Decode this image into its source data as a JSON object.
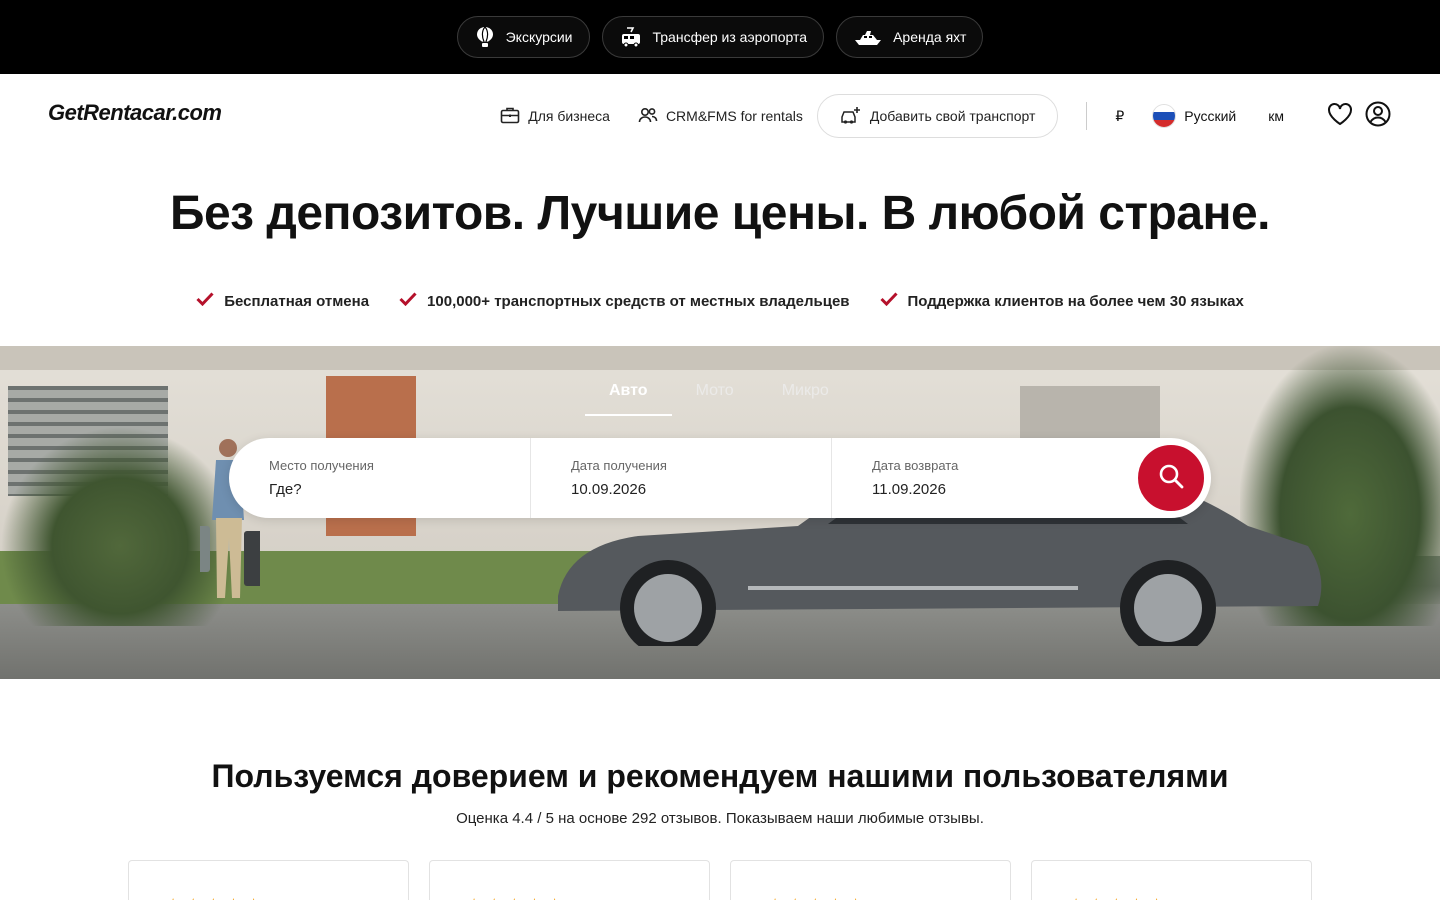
{
  "topbar": {
    "items": [
      {
        "label": "Экскурсии",
        "icon": "balloon-icon"
      },
      {
        "label": "Трансфер из аэропорта",
        "icon": "van-icon"
      },
      {
        "label": "Аренда яхт",
        "icon": "yacht-icon"
      }
    ]
  },
  "header": {
    "logo": "GetRentacar.com",
    "business": "Для бизнеса",
    "crm": "CRM&FMS for rentals",
    "add_vehicle": "Добавить свой транспорт",
    "currency": "₽",
    "language": "Русский",
    "units": "км"
  },
  "hero": {
    "title": "Без депозитов. Лучшие цены. В любой стране.",
    "features": [
      "Бесплатная отмена",
      "100,000+ транспортных средств от местных владельцев",
      "Поддержка клиентов на более чем 30 языках"
    ]
  },
  "search": {
    "tabs": [
      "Авто",
      "Мото",
      "Микро"
    ],
    "active_tab": "Авто",
    "pickup_label": "Место получения",
    "pickup_placeholder": "Где?",
    "pickup_date_label": "Дата получения",
    "pickup_date": "10.09.2026",
    "return_date_label": "Дата возврата",
    "return_date": "11.09.2026"
  },
  "reviews": {
    "title": "Пользуемся доверием и рекомендуем нашими пользователями",
    "subtitle": "Оценка 4.4 / 5 на основе 292 отзывов. Показываем наши любимые отзывы.",
    "stars": "★★★★★"
  },
  "colors": {
    "accent": "#c8102e",
    "check": "#b5112b",
    "star": "#f5a623"
  }
}
